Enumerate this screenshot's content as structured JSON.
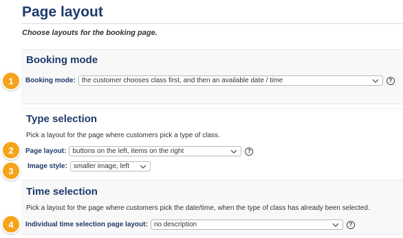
{
  "page": {
    "title": "Page layout",
    "subtitle": "Choose layouts for the booking page."
  },
  "booking_mode": {
    "heading": "Booking mode",
    "label": "Booking mode:",
    "value": "the customer chooses class first, and then an available date / time",
    "badge": "1"
  },
  "type_selection": {
    "heading": "Type selection",
    "description": "Pick a layout for the page where customers pick a type of class.",
    "page_layout_label": "Page layout:",
    "page_layout_value": "buttons on the left, items on the right",
    "page_layout_badge": "2",
    "image_style_label": "Image style:",
    "image_style_value": "smaller image, left",
    "image_style_badge": "3"
  },
  "time_selection": {
    "heading": "Time selection",
    "description": "Pick a layout for the page where customers pick the date/time, when the type of class has already been selected.",
    "label": "Individual time selection page layout:",
    "value": "no description",
    "badge": "4"
  },
  "help_symbol": "?",
  "icons": [
    "chevron-down-icon",
    "help-icon",
    "step-badge"
  ],
  "colors": {
    "heading": "#1e3a6b",
    "badge": "#f5a31a",
    "section_bg": "#f8f8f8"
  }
}
